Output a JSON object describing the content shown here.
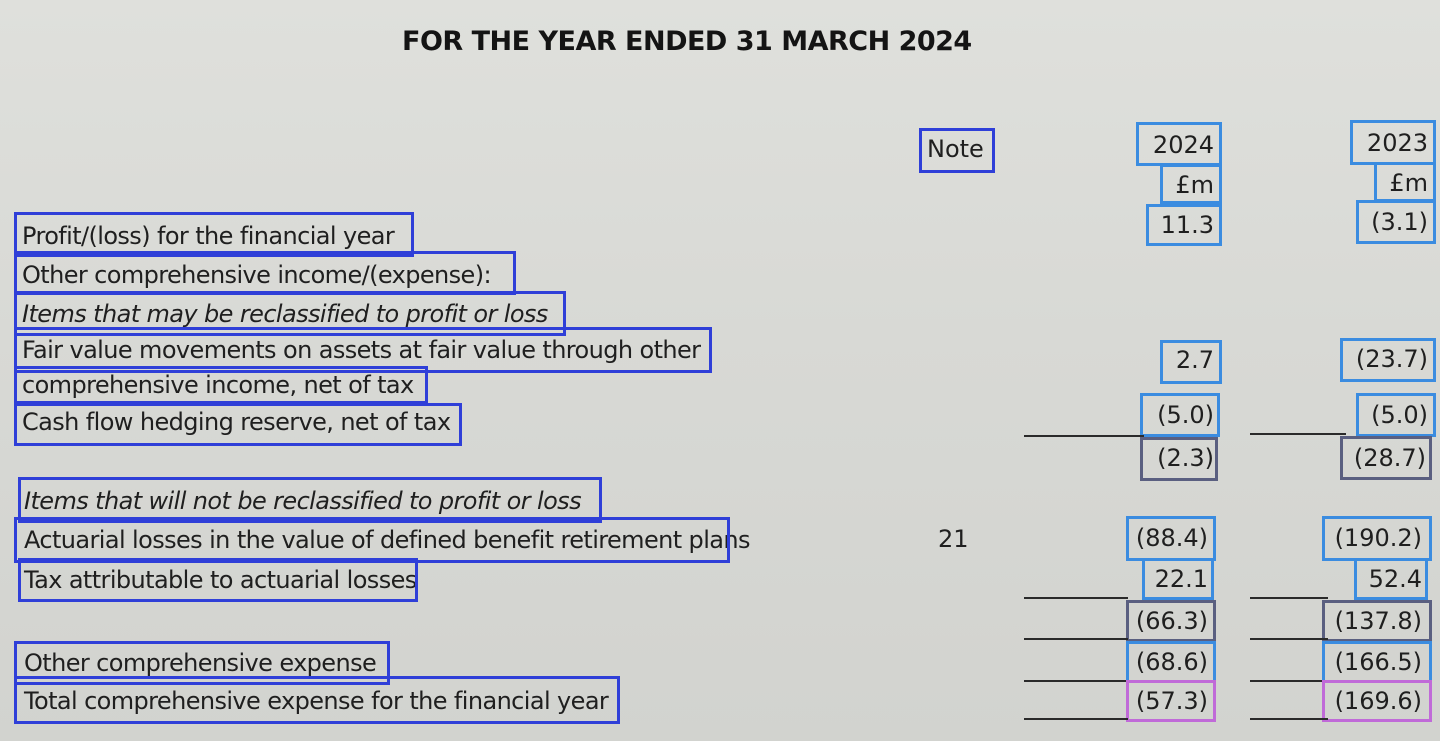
{
  "title": "FOR THE YEAR ENDED 31 MARCH 2024",
  "headers": {
    "note": "Note",
    "year_current": "2024",
    "year_prior": "2023",
    "unit_current": "£m",
    "unit_prior": "£m"
  },
  "rows": {
    "profit_label": "Profit/(loss) for the financial year",
    "profit_2024": "11.3",
    "profit_2023": "(3.1)",
    "oci_label": "Other comprehensive income/(expense):",
    "reclass_label": "Items that may be reclassified to profit or loss",
    "fv_label_1": "Fair value movements on assets at fair value through other",
    "fv_label_2": "comprehensive income, net of tax",
    "fv_2024": "2.7",
    "fv_2023": "(23.7)",
    "cfh_label": "Cash flow hedging reserve, net of tax",
    "cfh_2024": "(5.0)",
    "cfh_2023": "(5.0)",
    "sub1_2024": "(2.3)",
    "sub1_2023": "(28.7)",
    "noreclass_label": "Items that will not be reclassified to profit or loss",
    "act_label": "Actuarial losses in the value of defined benefit retirement plans",
    "act_note": "21",
    "act_2024": "(88.4)",
    "act_2023": "(190.2)",
    "tax_label": "Tax attributable to actuarial losses",
    "tax_2024": "22.1",
    "tax_2023": "52.4",
    "sub2_2024": "(66.3)",
    "sub2_2023": "(137.8)",
    "oce_label": "Other comprehensive expense",
    "oce_2024": "(68.6)",
    "oce_2023": "(166.5)",
    "total_label": "Total comprehensive expense for the financial year",
    "total_2024": "(57.3)",
    "total_2023": "(169.6)"
  }
}
